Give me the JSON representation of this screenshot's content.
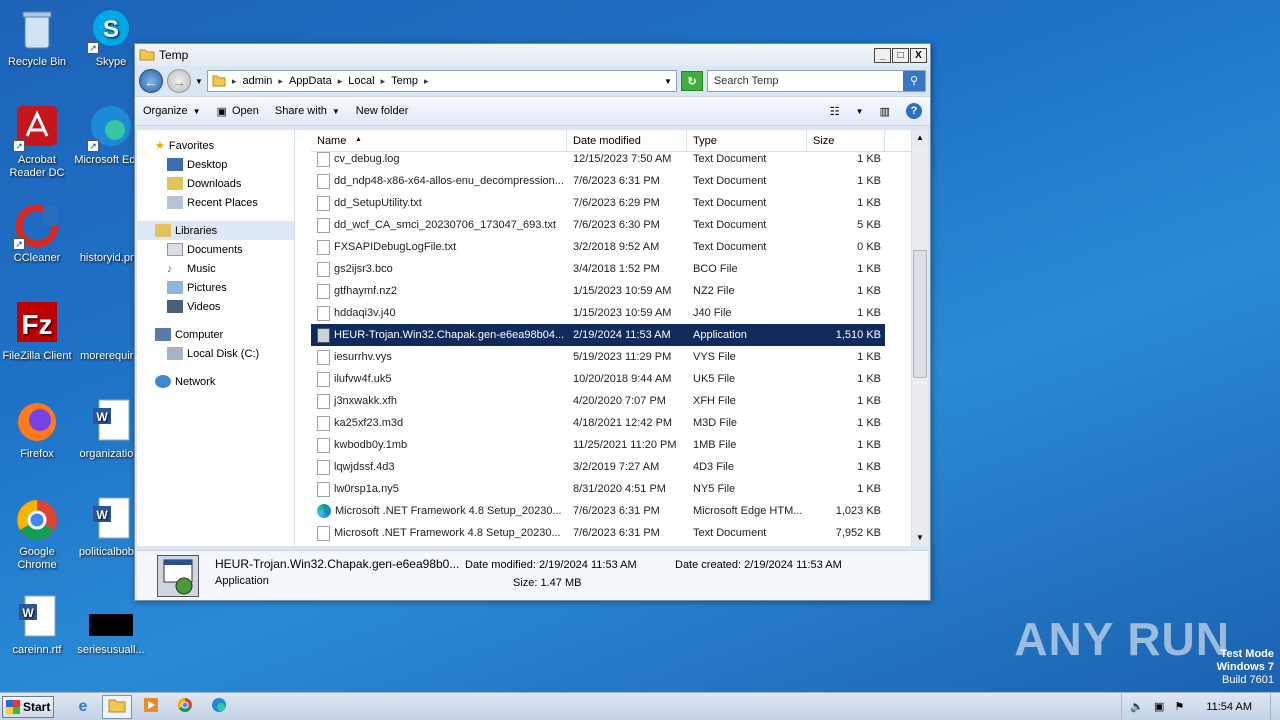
{
  "desktop": {
    "icons": [
      {
        "label": "Recycle Bin",
        "icon": "recycle-bin-icon"
      },
      {
        "label": "Skype",
        "icon": "skype-icon"
      },
      {
        "label": "Acrobat Reader DC",
        "icon": "acrobat-icon"
      },
      {
        "label": "Microsoft Edge",
        "icon": "edge-icon"
      },
      {
        "label": "CCleaner",
        "icon": "ccleaner-icon"
      },
      {
        "label": "historyid.png",
        "icon": "image-icon"
      },
      {
        "label": "FileZilla Client",
        "icon": "filezilla-icon"
      },
      {
        "label": "morerequir...",
        "icon": "file-icon"
      },
      {
        "label": "Firefox",
        "icon": "firefox-icon"
      },
      {
        "label": "organizatio...",
        "icon": "word-doc-icon"
      },
      {
        "label": "Google Chrome",
        "icon": "chrome-icon"
      },
      {
        "label": "politicalbob...",
        "icon": "word-doc-icon"
      },
      {
        "label": "careinn.rtf",
        "icon": "word-doc-icon"
      },
      {
        "label": "seriesusuall...",
        "icon": "black-thumbnail-icon"
      }
    ],
    "watermark": "ANY RUN",
    "test_mode": [
      "Test Mode",
      "Windows 7",
      "Build 7601"
    ]
  },
  "window": {
    "title": "Temp",
    "buttons": {
      "minimize": "_",
      "maximize": "□",
      "close": "X"
    },
    "breadcrumb": [
      "admin",
      "AppData",
      "Local",
      "Temp"
    ],
    "search_placeholder": "Search Temp",
    "toolbar": {
      "organize": "Organize",
      "open": "Open",
      "share_with": "Share with",
      "new_folder": "New folder"
    },
    "nav": {
      "favorites": "Favorites",
      "desktop": "Desktop",
      "downloads": "Downloads",
      "recent": "Recent Places",
      "libraries": "Libraries",
      "documents": "Documents",
      "music": "Music",
      "pictures": "Pictures",
      "videos": "Videos",
      "computer": "Computer",
      "local_disk": "Local Disk (C:)",
      "network": "Network"
    },
    "columns": {
      "name": "Name",
      "date": "Date modified",
      "type": "Type",
      "size": "Size"
    },
    "files": [
      {
        "name": "cv_debug.log",
        "date": "12/15/2023 7:50 AM",
        "type": "Text Document",
        "size": "1 KB",
        "kind": "doc"
      },
      {
        "name": "dd_ndp48-x86-x64-allos-enu_decompression...",
        "date": "7/6/2023 6:31 PM",
        "type": "Text Document",
        "size": "1 KB",
        "kind": "doc"
      },
      {
        "name": "dd_SetupUtility.txt",
        "date": "7/6/2023 6:29 PM",
        "type": "Text Document",
        "size": "1 KB",
        "kind": "doc"
      },
      {
        "name": "dd_wcf_CA_smci_20230706_173047_693.txt",
        "date": "7/6/2023 6:30 PM",
        "type": "Text Document",
        "size": "5 KB",
        "kind": "doc"
      },
      {
        "name": "FXSAPIDebugLogFile.txt",
        "date": "3/2/2018 9:52 AM",
        "type": "Text Document",
        "size": "0 KB",
        "kind": "doc"
      },
      {
        "name": "gs2ijsr3.bco",
        "date": "3/4/2018 1:52 PM",
        "type": "BCO File",
        "size": "1 KB",
        "kind": "doc"
      },
      {
        "name": "gtfhaymf.nz2",
        "date": "1/15/2023 10:59 AM",
        "type": "NZ2 File",
        "size": "1 KB",
        "kind": "doc"
      },
      {
        "name": "hddaqi3v.j40",
        "date": "1/15/2023 10:59 AM",
        "type": "J40 File",
        "size": "1 KB",
        "kind": "doc"
      },
      {
        "name": "HEUR-Trojan.Win32.Chapak.gen-e6ea98b04...",
        "date": "2/19/2024 11:53 AM",
        "type": "Application",
        "size": "1,510 KB",
        "kind": "app",
        "selected": true
      },
      {
        "name": "iesurrhv.vys",
        "date": "5/19/2023 11:29 PM",
        "type": "VYS File",
        "size": "1 KB",
        "kind": "doc"
      },
      {
        "name": "ilufvw4f.uk5",
        "date": "10/20/2018 9:44 AM",
        "type": "UK5 File",
        "size": "1 KB",
        "kind": "doc"
      },
      {
        "name": "j3nxwakk.xfh",
        "date": "4/20/2020 7:07 PM",
        "type": "XFH File",
        "size": "1 KB",
        "kind": "doc"
      },
      {
        "name": "ka25xf23.m3d",
        "date": "4/18/2021 12:42 PM",
        "type": "M3D File",
        "size": "1 KB",
        "kind": "doc"
      },
      {
        "name": "kwbodb0y.1mb",
        "date": "11/25/2021 11:20 PM",
        "type": "1MB File",
        "size": "1 KB",
        "kind": "doc"
      },
      {
        "name": "lqwjdssf.4d3",
        "date": "3/2/2019 7:27 AM",
        "type": "4D3 File",
        "size": "1 KB",
        "kind": "doc"
      },
      {
        "name": "lw0rsp1a.ny5",
        "date": "8/31/2020 4:51 PM",
        "type": "NY5 File",
        "size": "1 KB",
        "kind": "doc"
      },
      {
        "name": "Microsoft .NET Framework 4.8 Setup_20230...",
        "date": "7/6/2023 6:31 PM",
        "type": "Microsoft Edge HTM...",
        "size": "1,023 KB",
        "kind": "edge"
      },
      {
        "name": "Microsoft .NET Framework 4.8 Setup_20230...",
        "date": "7/6/2023 6:31 PM",
        "type": "Text Document",
        "size": "7,952 KB",
        "kind": "doc"
      }
    ],
    "details": {
      "name": "HEUR-Trojan.Win32.Chapak.gen-e6ea98b0...",
      "type": "Application",
      "date_modified": "Date modified: 2/19/2024 11:53 AM",
      "date_created": "Date created: 2/19/2024 11:53 AM",
      "size": "Size: 1.47 MB"
    }
  },
  "taskbar": {
    "start": "Start",
    "clock": "11:54 AM"
  }
}
